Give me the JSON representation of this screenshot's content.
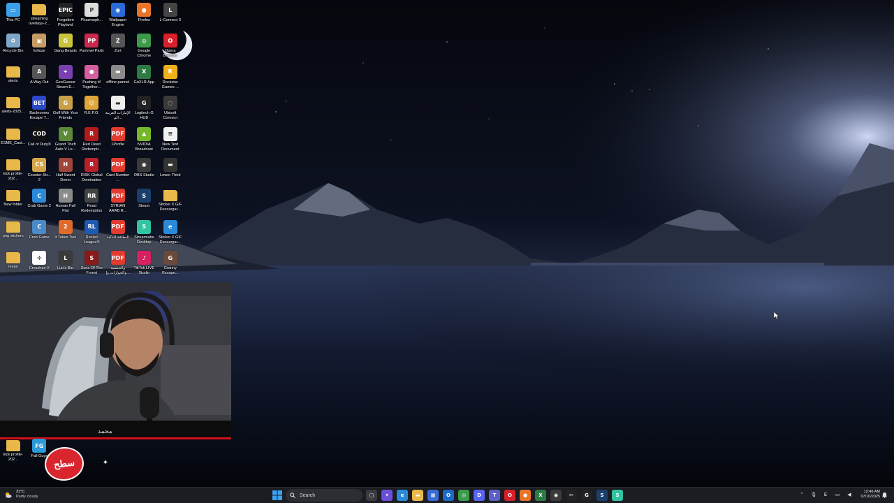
{
  "desktop": {
    "icons": [
      {
        "label": "This PC",
        "icon": "monitor-icon",
        "color": "#3aa0e8",
        "glyph": "▭"
      },
      {
        "label": "streaming overlays-2...",
        "icon": "folder-icon",
        "color": "#e9b84a",
        "glyph": ""
      },
      {
        "label": "Forgotten Playland",
        "icon": "epic-games-icon",
        "color": "#222222",
        "glyph": "EPIC"
      },
      {
        "label": "Phasmoph...",
        "icon": "phasmophobia-icon",
        "color": "#dddddd",
        "glyph": "P"
      },
      {
        "label": "Wallpaper Engine",
        "icon": "wallpaper-engine-icon",
        "color": "#2a6ad8",
        "glyph": "◉"
      },
      {
        "label": "Firefox",
        "icon": "firefox-icon",
        "color": "#e8742a",
        "glyph": "●"
      },
      {
        "label": "L-Connect 3",
        "icon": "lconnect-icon",
        "color": "#444444",
        "glyph": "L"
      },
      {
        "label": "Recycle Bin",
        "icon": "recycle-bin-icon",
        "color": "#7fa6c9",
        "glyph": "♻"
      },
      {
        "label": "fullsize",
        "icon": "image-file-icon",
        "color": "#c59c63",
        "glyph": "▣"
      },
      {
        "label": "Gang Beasts",
        "icon": "gang-beasts-icon",
        "color": "#c9c43a",
        "glyph": "G"
      },
      {
        "label": "Pummel Party",
        "icon": "pummel-party-icon",
        "color": "#c8294c",
        "glyph": "PP"
      },
      {
        "label": "Zort",
        "icon": "zort-icon",
        "color": "#555555",
        "glyph": "Z"
      },
      {
        "label": "Google Chrome",
        "icon": "chrome-icon",
        "color": "#3c9a4a",
        "glyph": "◎"
      },
      {
        "label": "Opera Browser",
        "icon": "opera-icon",
        "color": "#d9202a",
        "glyph": "O"
      },
      {
        "label": "alerts",
        "icon": "folder-icon",
        "color": "#e9b84a",
        "glyph": ""
      },
      {
        "label": "A Way Out",
        "icon": "a-way-out-icon",
        "color": "#555555",
        "glyph": "A"
      },
      {
        "label": "GeoGuessr Steam E...",
        "icon": "geoguessr-icon",
        "color": "#7a3fb0",
        "glyph": "⌖"
      },
      {
        "label": "Pushing it! Together...",
        "icon": "pushing-it-icon",
        "color": "#d45fa0",
        "glyph": "●"
      },
      {
        "label": "offline pannel",
        "icon": "image-file-icon",
        "color": "#8a8a8a",
        "glyph": "▬"
      },
      {
        "label": "GoXLR App",
        "icon": "goxlr-icon",
        "color": "#2d7a45",
        "glyph": "X"
      },
      {
        "label": "Rockstar Games ...",
        "icon": "rockstar-icon",
        "color": "#f0b01c",
        "glyph": "R"
      },
      {
        "label": "alerts-2025...",
        "icon": "folder-icon",
        "color": "#e9b84a",
        "glyph": ""
      },
      {
        "label": "Backrooms Escape T...",
        "icon": "backrooms-icon",
        "color": "#2b48c8",
        "glyph": "BET"
      },
      {
        "label": "Golf With Your Friends",
        "icon": "golf-icon",
        "color": "#c7a04a",
        "glyph": "G"
      },
      {
        "label": "R.E.P.O.",
        "icon": "repo-icon",
        "color": "#e0a53a",
        "glyph": "☺"
      },
      {
        "label": "الإمارات العربية الم...",
        "icon": "document-icon",
        "color": "#eeeeee",
        "glyph": "▬"
      },
      {
        "label": "Logitech G HUB",
        "icon": "logitech-icon",
        "color": "#222222",
        "glyph": "G"
      },
      {
        "label": "Ubisoft Connect",
        "icon": "ubisoft-icon",
        "color": "#3a3a3a",
        "glyph": "◌"
      },
      {
        "label": "ESME_Cast...",
        "icon": "folder-icon",
        "color": "#e9b84a",
        "glyph": ""
      },
      {
        "label": "Call of Duty®",
        "icon": "call-of-duty-icon",
        "color": "#111111",
        "glyph": "COD"
      },
      {
        "label": "Grand Theft Auto V Le...",
        "icon": "gta-icon",
        "color": "#5c8a3a",
        "glyph": "V"
      },
      {
        "label": "Red Dead Redempti...",
        "icon": "red-dead-icon",
        "color": "#b01c1c",
        "glyph": "R"
      },
      {
        "label": "1Profile",
        "icon": "pdf-icon",
        "color": "#e23b30",
        "glyph": "PDF"
      },
      {
        "label": "NVIDIA Broadcast",
        "icon": "nvidia-icon",
        "color": "#76b82a",
        "glyph": "▲"
      },
      {
        "label": "New Text Document",
        "icon": "text-document-icon",
        "color": "#f2f2f2",
        "glyph": "≡"
      },
      {
        "label": "kick profile-202...",
        "icon": "folder-icon",
        "color": "#e9b84a",
        "glyph": ""
      },
      {
        "label": "Counter-Str... 2",
        "icon": "counter-strike-icon",
        "color": "#d6a64a",
        "glyph": "CS"
      },
      {
        "label": "Half Sword Demo",
        "icon": "half-sword-icon",
        "color": "#a0453a",
        "glyph": "H"
      },
      {
        "label": "RISK Global Domination",
        "icon": "risk-icon",
        "color": "#b8202a",
        "glyph": "R"
      },
      {
        "label": "Card Number ...",
        "icon": "pdf-icon",
        "color": "#e23b30",
        "glyph": "PDF"
      },
      {
        "label": "OBS Studio",
        "icon": "obs-icon",
        "color": "#3a3a3a",
        "glyph": "◉"
      },
      {
        "label": "Lower Third",
        "icon": "image-file-icon",
        "color": "#333333",
        "glyph": "▬"
      },
      {
        "label": "New folder",
        "icon": "folder-icon",
        "color": "#e9b84a",
        "glyph": ""
      },
      {
        "label": "Crab Game 2",
        "icon": "crab-game-icon",
        "color": "#2b8ad8",
        "glyph": "C"
      },
      {
        "label": "Human Fall Flat",
        "icon": "human-fall-flat-icon",
        "color": "#8a8a8a",
        "glyph": "H"
      },
      {
        "label": "Road Redemption",
        "icon": "road-redemption-icon",
        "color": "#444444",
        "glyph": "RR"
      },
      {
        "label": "SYRIAN ARAB R...",
        "icon": "pdf-icon",
        "color": "#e23b30",
        "glyph": "PDF"
      },
      {
        "label": "Steam",
        "icon": "steam-icon",
        "color": "#1b3f6a",
        "glyph": "S"
      },
      {
        "label": "Sticker X GIF Descargar...",
        "icon": "folder-icon",
        "color": "#e9b84a",
        "glyph": ""
      },
      {
        "label": "png stickers",
        "icon": "folder-icon",
        "color": "#e9b84a",
        "glyph": ""
      },
      {
        "label": "Crab Game",
        "icon": "crab-game-icon",
        "color": "#4a8ac8",
        "glyph": "C"
      },
      {
        "label": "It Takes Two",
        "icon": "it-takes-two-icon",
        "color": "#e06a2a",
        "glyph": "2"
      },
      {
        "label": "Rocket League®",
        "icon": "rocket-league-icon",
        "color": "#1f5ab0",
        "glyph": "RL"
      },
      {
        "label": "البطاقة الذكية",
        "icon": "pdf-icon",
        "color": "#e23b30",
        "glyph": "PDF"
      },
      {
        "label": "Streamlabs Desktop",
        "icon": "streamlabs-icon",
        "color": "#31c3a2",
        "glyph": "S"
      },
      {
        "label": "Sticker X GIF Descargar...",
        "icon": "edge-icon",
        "color": "#2a8ad8",
        "glyph": "e"
      },
      {
        "label": "reepo",
        "icon": "folder-icon",
        "color": "#e9b84a",
        "glyph": ""
      },
      {
        "label": "Crosshair X",
        "icon": "crosshair-icon",
        "color": "#ffffff",
        "glyph": "✛"
      },
      {
        "label": "Liar's Bar",
        "icon": "liars-bar-icon",
        "color": "#3a3a3a",
        "glyph": "L"
      },
      {
        "label": "Sons Of The Forest",
        "icon": "sons-of-forest-icon",
        "color": "#8a1a1a",
        "glyph": "S"
      },
      {
        "label": "والجنسية والجوازات وإ...",
        "icon": "pdf-icon",
        "color": "#e23b30",
        "glyph": "PDF"
      },
      {
        "label": "TikTok LIVE Studio",
        "icon": "tiktok-icon",
        "color": "#d62060",
        "glyph": "♪"
      },
      {
        "label": "Granny Escape...",
        "icon": "granny-icon",
        "color": "#6a4a3a",
        "glyph": "G"
      }
    ],
    "lower_icons": [
      {
        "label": "kick profile-202...",
        "icon": "folder-icon",
        "color": "#e9b84a",
        "glyph": ""
      },
      {
        "label": "Fall Guys",
        "icon": "fall-guys-icon",
        "color": "#2a9ad8",
        "glyph": "FG"
      }
    ]
  },
  "webcam": {
    "name_tag": "محمد"
  },
  "overlay": {
    "logo_text": "سطح",
    "social_icon": "twitter-icon"
  },
  "taskbar": {
    "weather": {
      "temp": "31°C",
      "condition": "Partly cloudy"
    },
    "search_placeholder": "Search",
    "apps": [
      {
        "icon": "task-view-icon",
        "color": "#3a3b40",
        "glyph": "▢"
      },
      {
        "icon": "copilot-icon",
        "color": "#6a4fd8",
        "glyph": "✦"
      },
      {
        "icon": "edge-icon",
        "color": "#2a8ad8",
        "glyph": "e"
      },
      {
        "icon": "file-explorer-icon",
        "color": "#e9b84a",
        "glyph": "▬"
      },
      {
        "icon": "store-icon",
        "color": "#3a6ad8",
        "glyph": "▦"
      },
      {
        "icon": "outlook-icon",
        "color": "#1a6ac8",
        "glyph": "O"
      },
      {
        "icon": "chrome-icon",
        "color": "#3c9a4a",
        "glyph": "◎"
      },
      {
        "icon": "discord-icon",
        "color": "#5865f2",
        "glyph": "D"
      },
      {
        "icon": "teams-icon",
        "color": "#5b5fc7",
        "glyph": "T"
      },
      {
        "icon": "opera-icon",
        "color": "#d9202a",
        "glyph": "O"
      },
      {
        "icon": "firefox-icon",
        "color": "#e8742a",
        "glyph": "●"
      },
      {
        "icon": "goxlr-icon",
        "color": "#2d7a45",
        "glyph": "X"
      },
      {
        "icon": "obs-icon",
        "color": "#3a3a3a",
        "glyph": "◉"
      },
      {
        "icon": "capcut-icon",
        "color": "#222222",
        "glyph": "✂"
      },
      {
        "icon": "logitech-icon",
        "color": "#222222",
        "glyph": "G"
      },
      {
        "icon": "steam-icon",
        "color": "#1b3f6a",
        "glyph": "S"
      },
      {
        "icon": "streamlabs-icon",
        "color": "#31c3a2",
        "glyph": "S"
      }
    ],
    "tray_input": "E",
    "clock": {
      "time": "12:46 AM",
      "date": "07/10/2025"
    }
  }
}
